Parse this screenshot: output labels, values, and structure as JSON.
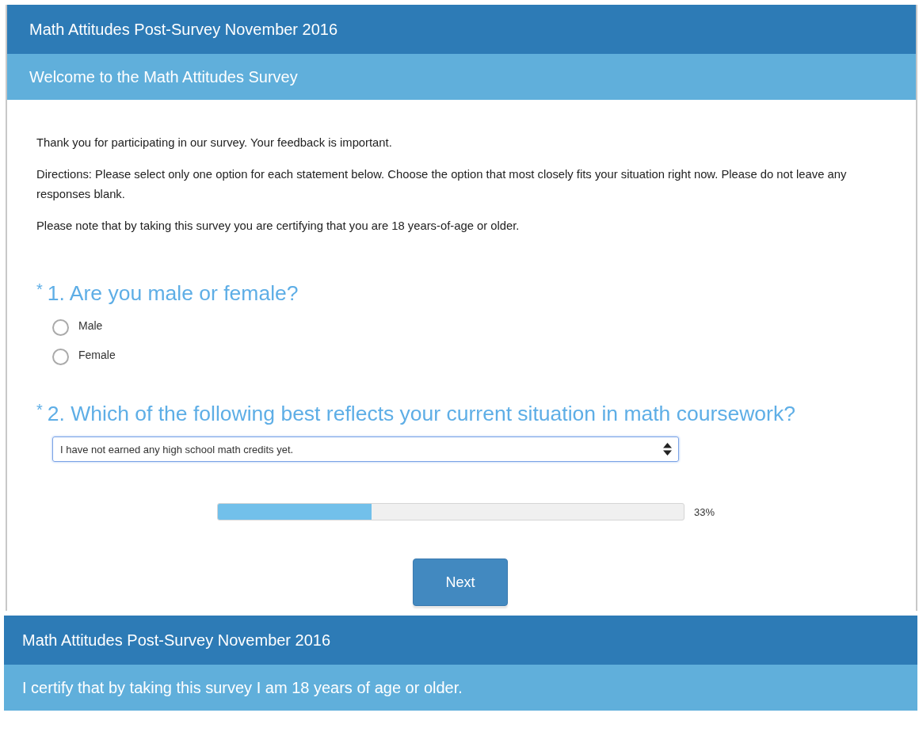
{
  "survey_page": {
    "title": "Math Attitudes Post-Survey November 2016",
    "page_title": "Welcome to the Math Attitudes Survey",
    "intro": [
      "Thank you for participating in our survey. Your feedback is important.",
      "Directions: Please select only one option for each statement below. Choose the option that most closely fits your situation right now. Please do not leave any responses blank.",
      "Please note that by taking this survey you are certifying that you are 18 years-of-age or older."
    ],
    "questions": [
      {
        "kind": "radio",
        "required": true,
        "marker": "*",
        "title": "1. Are you male or female?",
        "options": [
          {
            "label": "Male",
            "selected": false
          },
          {
            "label": "Female",
            "selected": false
          }
        ]
      },
      {
        "kind": "dropdown",
        "required": true,
        "marker": "*",
        "title": "2. Which of the following best reflects your current situation in math coursework?",
        "value": "I have not earned any high school math credits yet."
      }
    ],
    "progress": {
      "level": 0.33,
      "reading": "33%"
    },
    "next_button": "Next"
  },
  "second_page": {
    "title": "Math Attitudes Post-Survey November 2016",
    "page_title": "I certify that by taking this survey I am 18 years of age or older."
  }
}
